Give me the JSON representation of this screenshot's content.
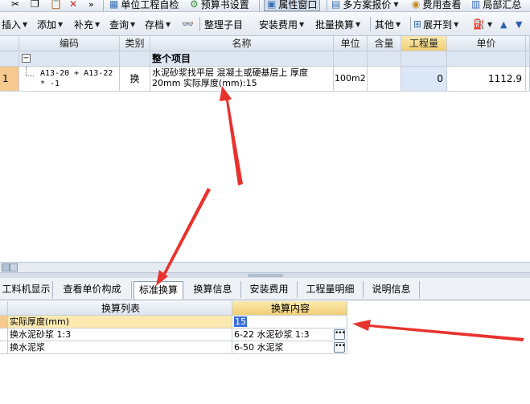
{
  "toolbar_top": {
    "unit_project": "单位工程自检",
    "budget_settings": "预算书设置",
    "property_window": "属性窗口",
    "multi_plan": "多方案报价",
    "cost_view": "费用查看",
    "partial_summary": "局部汇总",
    "more": "»"
  },
  "toolbar_main": {
    "insert": "插入",
    "add": "添加",
    "supplement": "补充",
    "query": "查询",
    "archive": "存档",
    "sort_children": "整理子目",
    "install_fee": "安装费用",
    "batch_convert": "批量换算",
    "other": "其他",
    "expand_to": "展开到"
  },
  "main_table": {
    "columns": [
      "编码",
      "类别",
      "名称",
      "单位",
      "含量",
      "工程量",
      "单价"
    ],
    "group_row": {
      "collapse": "−",
      "name": "整个项目"
    },
    "rows": [
      {
        "index": "1",
        "code": "A13-20 + A13-22 * -1",
        "category": "换",
        "name": "水泥砂浆找平层 混凝土或硬基层上 厚度20mm 实际厚度(mm):15",
        "unit": "100m2",
        "content": "",
        "quantity": "0",
        "unit_price": "1112.9"
      }
    ]
  },
  "tabs": [
    {
      "label": "工料机显示",
      "active": false
    },
    {
      "label": "查看单价构成",
      "active": false
    },
    {
      "label": "标准换算",
      "active": true
    },
    {
      "label": "换算信息",
      "active": false
    },
    {
      "label": "安装费用",
      "active": false
    },
    {
      "label": "工程量明细",
      "active": false
    },
    {
      "label": "说明信息",
      "active": false
    }
  ],
  "conversion_table": {
    "columns": [
      "换算列表",
      "换算内容"
    ],
    "rows": [
      {
        "label": "实际厚度(mm)",
        "value": "15",
        "has_button": false
      },
      {
        "label": "换水泥砂浆 1:3",
        "value": "6-22  水泥砂浆 1:3",
        "has_button": true
      },
      {
        "label": "换水泥浆",
        "value": "6-50  水泥浆",
        "has_button": true
      }
    ]
  },
  "colors": {
    "arrow": "#e8322e",
    "header_highlight": "#f0cf74",
    "row_number": "#f6c98f",
    "quantity_cell": "#dbe7f6",
    "selection": "#3a6fd8"
  }
}
